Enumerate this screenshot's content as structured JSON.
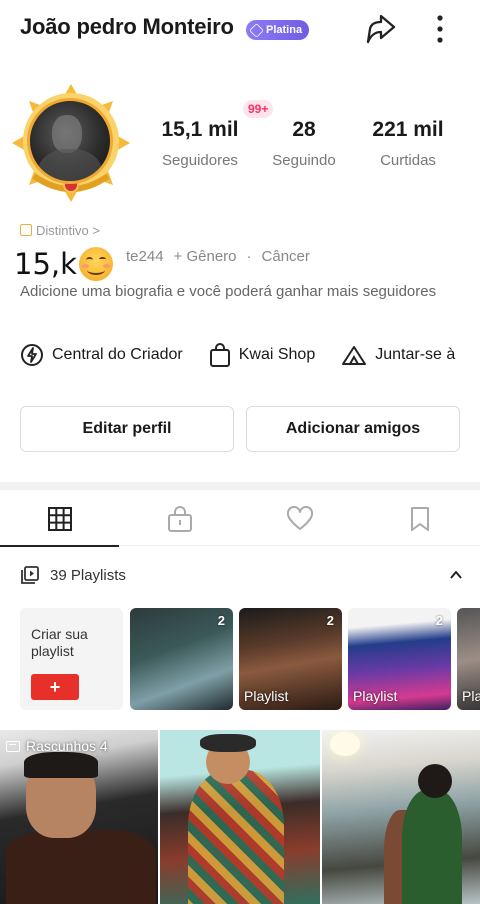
{
  "profile": {
    "name": "João pedro Monteiro",
    "badge": "Platina",
    "notification_count": "99+",
    "stats": [
      {
        "value": "15,1 mil",
        "label": "Seguidores"
      },
      {
        "value": "28",
        "label": "Seguindo"
      },
      {
        "value": "221 mil",
        "label": "Curtidas"
      }
    ],
    "distintivo": "Distintivo >",
    "overlay_count": "15,k",
    "tags": [
      "te244",
      "+ Gênero",
      "·",
      "Câncer"
    ],
    "bio": "Adicione uma biografia e você poderá ganhar mais seguidores"
  },
  "shortcuts": [
    {
      "label": "Central do Criador",
      "icon": "lightning-circle-icon"
    },
    {
      "label": "Kwai Shop",
      "icon": "shopping-bag-icon"
    },
    {
      "label": "Juntar-se à",
      "icon": "tent-icon"
    }
  ],
  "buttons": {
    "edit": "Editar perfil",
    "add_friends": "Adicionar amigos"
  },
  "tabs": [
    {
      "name": "grid",
      "icon": "grid-icon",
      "active": true
    },
    {
      "name": "private",
      "icon": "lock-icon",
      "active": false
    },
    {
      "name": "liked",
      "icon": "heart-icon",
      "active": false
    },
    {
      "name": "saved",
      "icon": "bookmark-icon",
      "active": false
    }
  ],
  "playlists": {
    "header": "39 Playlists",
    "create_label": "Criar sua playlist",
    "create_button": "+",
    "items": [
      {
        "count": "2",
        "label": ""
      },
      {
        "count": "2",
        "label": "Playlist"
      },
      {
        "count": "2",
        "label": "Playlist"
      },
      {
        "count": "",
        "label": "Pla"
      }
    ]
  },
  "drafts": {
    "label": "Rascunhos 4"
  },
  "colors": {
    "accent": "#e8302a",
    "badge_purple": "#7b68ee",
    "notif_pink": "#ff2d63",
    "avatar_frame": "#f0a830"
  }
}
